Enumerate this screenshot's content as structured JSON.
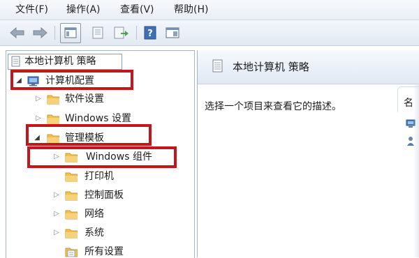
{
  "menubar": {
    "file": "文件(F)",
    "action": "操作(A)",
    "view": "查看(V)",
    "help": "帮助(H)"
  },
  "toolbar": {
    "buttons": [
      "back",
      "forward",
      "show-hide-tree",
      "properties",
      "export-list",
      "help",
      "show-hide-action-pane"
    ]
  },
  "tree": {
    "root": "本地计算机 策略",
    "computer_config": "计算机配置",
    "software_settings": "软件设置",
    "windows_settings": "Windows 设置",
    "admin_templates": "管理模板",
    "windows_components": "Windows 组件",
    "printers": "打印机",
    "control_panel": "控制面板",
    "network": "网络",
    "system": "系统",
    "all_settings": "所有设置"
  },
  "right": {
    "title": "本地计算机 策略",
    "description": "选择一个项目来查看它的描述。",
    "column_header": "名"
  },
  "colors": {
    "highlight_box": "#c4161c",
    "folder": "#f2c04f",
    "pane_border": "#a9b3c0"
  }
}
